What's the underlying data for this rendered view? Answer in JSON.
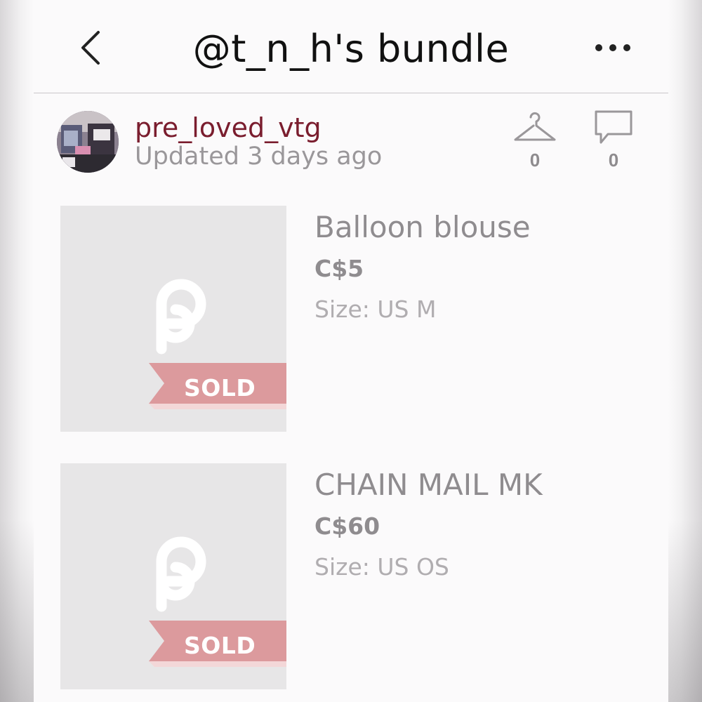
{
  "header": {
    "title": "@t_n_h's bundle",
    "back_icon": "chevron-left-icon",
    "more_icon": "more-horizontal-icon"
  },
  "seller": {
    "username": "pre_loved_vtg",
    "updated": "Updated 3 days ago",
    "likes_count": "0",
    "comments_count": "0",
    "likes_icon": "hanger-icon",
    "comments_icon": "comment-bubble-icon"
  },
  "listings": [
    {
      "title": "Balloon blouse",
      "price": "C$5",
      "size": "Size: US M",
      "badge": "SOLD"
    },
    {
      "title": "CHAIN MAIL MK",
      "price": "C$60",
      "size": "Size: US OS",
      "badge": "SOLD"
    }
  ],
  "colors": {
    "username": "#7a1d2e",
    "sold_ribbon": "#dc9a9d",
    "muted_text": "#8f8c8f"
  }
}
